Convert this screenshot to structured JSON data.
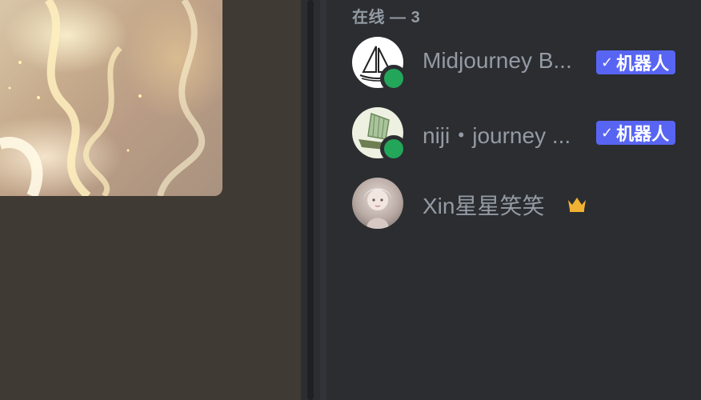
{
  "online_section": {
    "header": "在线 — 3"
  },
  "members": [
    {
      "name": "Midjourney B...",
      "status": "online",
      "bot": true,
      "bot_check": "✓",
      "bot_label": "机器人"
    },
    {
      "name": "niji・journey ...",
      "status": "online",
      "bot": true,
      "bot_check": "✓",
      "bot_label": "机器人"
    },
    {
      "name": "Xin星星笑笑",
      "status": "none",
      "owner_crown": true
    }
  ],
  "colors": {
    "status_online": "#23a55a",
    "bot_tag": "#5865f2",
    "crown": "#f0b232",
    "muted_text": "#949ba4"
  }
}
